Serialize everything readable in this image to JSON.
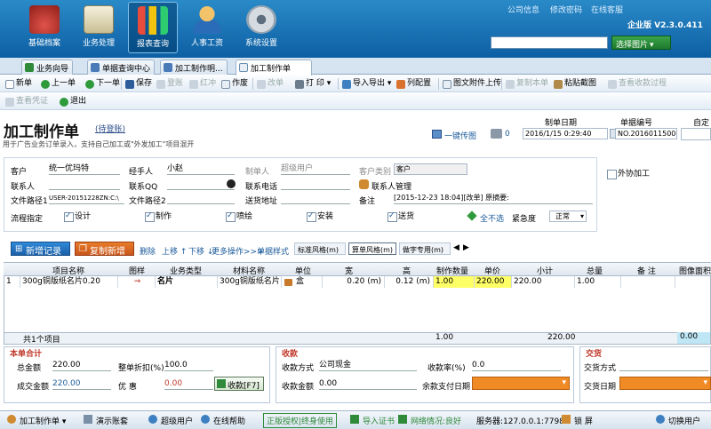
{
  "top_nav": {
    "items": [
      {
        "label": "基础档案",
        "color": "#c0392b"
      },
      {
        "label": "业务处理",
        "color": "#e8e0c0"
      },
      {
        "label": "报表查询",
        "color": "#e67e22"
      },
      {
        "label": "人事工资",
        "color": "#f0b040"
      },
      {
        "label": "系统设置",
        "color": "#c8d0d8"
      }
    ],
    "links": [
      "公司信息",
      "修改密码",
      "在线客服"
    ],
    "edition": "企业版 V2.3.0.411",
    "select_image_label": "选择图片"
  },
  "tabs": [
    "业务向导",
    "单据查询中心",
    "加工制作明...",
    "加工制作单"
  ],
  "toolbar1": {
    "new": "新单",
    "prev": "上一单",
    "next": "下一单",
    "save": "保存",
    "void": "登账",
    "red": "红冲",
    "cancel": "作废",
    "modify": "改单",
    "print": "打 印",
    "import_export": "导入导出",
    "columns": "列配置",
    "upload": "图文附件上传",
    "copy": "复制本单",
    "paste_img": "粘贴截图",
    "view_receipt": "查看收款过程"
  },
  "toolbar2": {
    "check_voucher": "查看凭证",
    "exit": "退出"
  },
  "form": {
    "title": "加工制作单",
    "status": "(待登账)",
    "description": "用于广告业务订单录入，支持自己加工或\"外发加工\"项目混开",
    "upload_label": "一键传图",
    "attachment_count": "0",
    "date_label": "制单日期",
    "date_value": "2016/1/15 0:29:40",
    "doc_no_label": "单据编号",
    "doc_no_value": "NO.201601150002",
    "custom_label": "自定"
  },
  "fields": {
    "customer_label": "客户",
    "customer_value": "统一优玛特",
    "handler_label": "经手人",
    "handler_value": "小赵",
    "maker_label": "制单人",
    "maker_value": "超级用户",
    "ctype_label": "客户类别",
    "ctype_value": "客户",
    "contact_label": "联系人",
    "qq_label": "联系QQ",
    "phone_label": "联系电话",
    "manage_label": "联系人管理",
    "path1_label": "文件路径1",
    "path1_value": "USER-20151228ZN:C:\\",
    "path2_label": "文件路径2",
    "addr_label": "送货地址",
    "note_label": "备注",
    "note_value": "[2015-12-23 18:04][改单] 原摘要:",
    "outsource_label": "外协加工",
    "flow_label": "流程指定",
    "flows": [
      "设计",
      "制作",
      "喷绘",
      "安装",
      "送货"
    ],
    "deselect_all": "全不选",
    "urgency_label": "紧急度",
    "urgency_value": "正常"
  },
  "grid_toolbar": {
    "add_record": "新增记录",
    "copy_add": "复制新增",
    "delete": "删除",
    "up": "上移",
    "down": "下移",
    "more": "更多操作>>>",
    "style": "单据样式",
    "style_tabs": [
      "标准风格(m)",
      "算单风格(m)",
      "做字专用(m)"
    ]
  },
  "grid": {
    "headers": [
      "项目名称",
      "图样",
      "业务类型",
      "材料名称",
      "单位",
      "宽",
      "高",
      "制作数量",
      "单价",
      "小计",
      "总量",
      "备 注",
      "图像面积"
    ],
    "rows": [
      [
        "1",
        "300g铜版纸名片0.20",
        "",
        "名片",
        "300g铜版纸名片",
        "盒",
        "0.20 (m)",
        "0.12 (m)",
        "1.00",
        "220.00",
        "220.00",
        "1.00",
        ""
      ]
    ],
    "footer": {
      "count": "共1个项目",
      "qty": "1.00",
      "subtotal": "220.00",
      "area": "0.00"
    }
  },
  "summary": {
    "title": "本单合计",
    "total_label": "总金额",
    "total_value": "220.00",
    "discount_label": "整单折扣(%)",
    "discount_value": "100.0",
    "deal_label": "成交金额",
    "deal_value": "220.00",
    "free_label": "优 惠",
    "free_value": "0.00",
    "collect_btn": "收款[F7]"
  },
  "receipt": {
    "title": "收款",
    "method_label": "收款方式",
    "method_value": "公司现金",
    "rate_label": "收款率(%)",
    "rate_value": "0.0",
    "amount_label": "收款金额",
    "amount_value": "0.00",
    "balance_label": "余款支付日期"
  },
  "delivery": {
    "title": "交货",
    "method_label": "交货方式",
    "date_label": "交货日期"
  },
  "status_bar": {
    "module": "加工制作单",
    "demo": "演示账套",
    "user": "超级用户",
    "help": "在线帮助",
    "license": "正版授权|终身使用",
    "import_cert": "导入证书",
    "network": "网络情况:良好",
    "server": "服务器:127.0.0.1:7798",
    "lock": "锁 屏",
    "switch_user": "切换用户"
  }
}
